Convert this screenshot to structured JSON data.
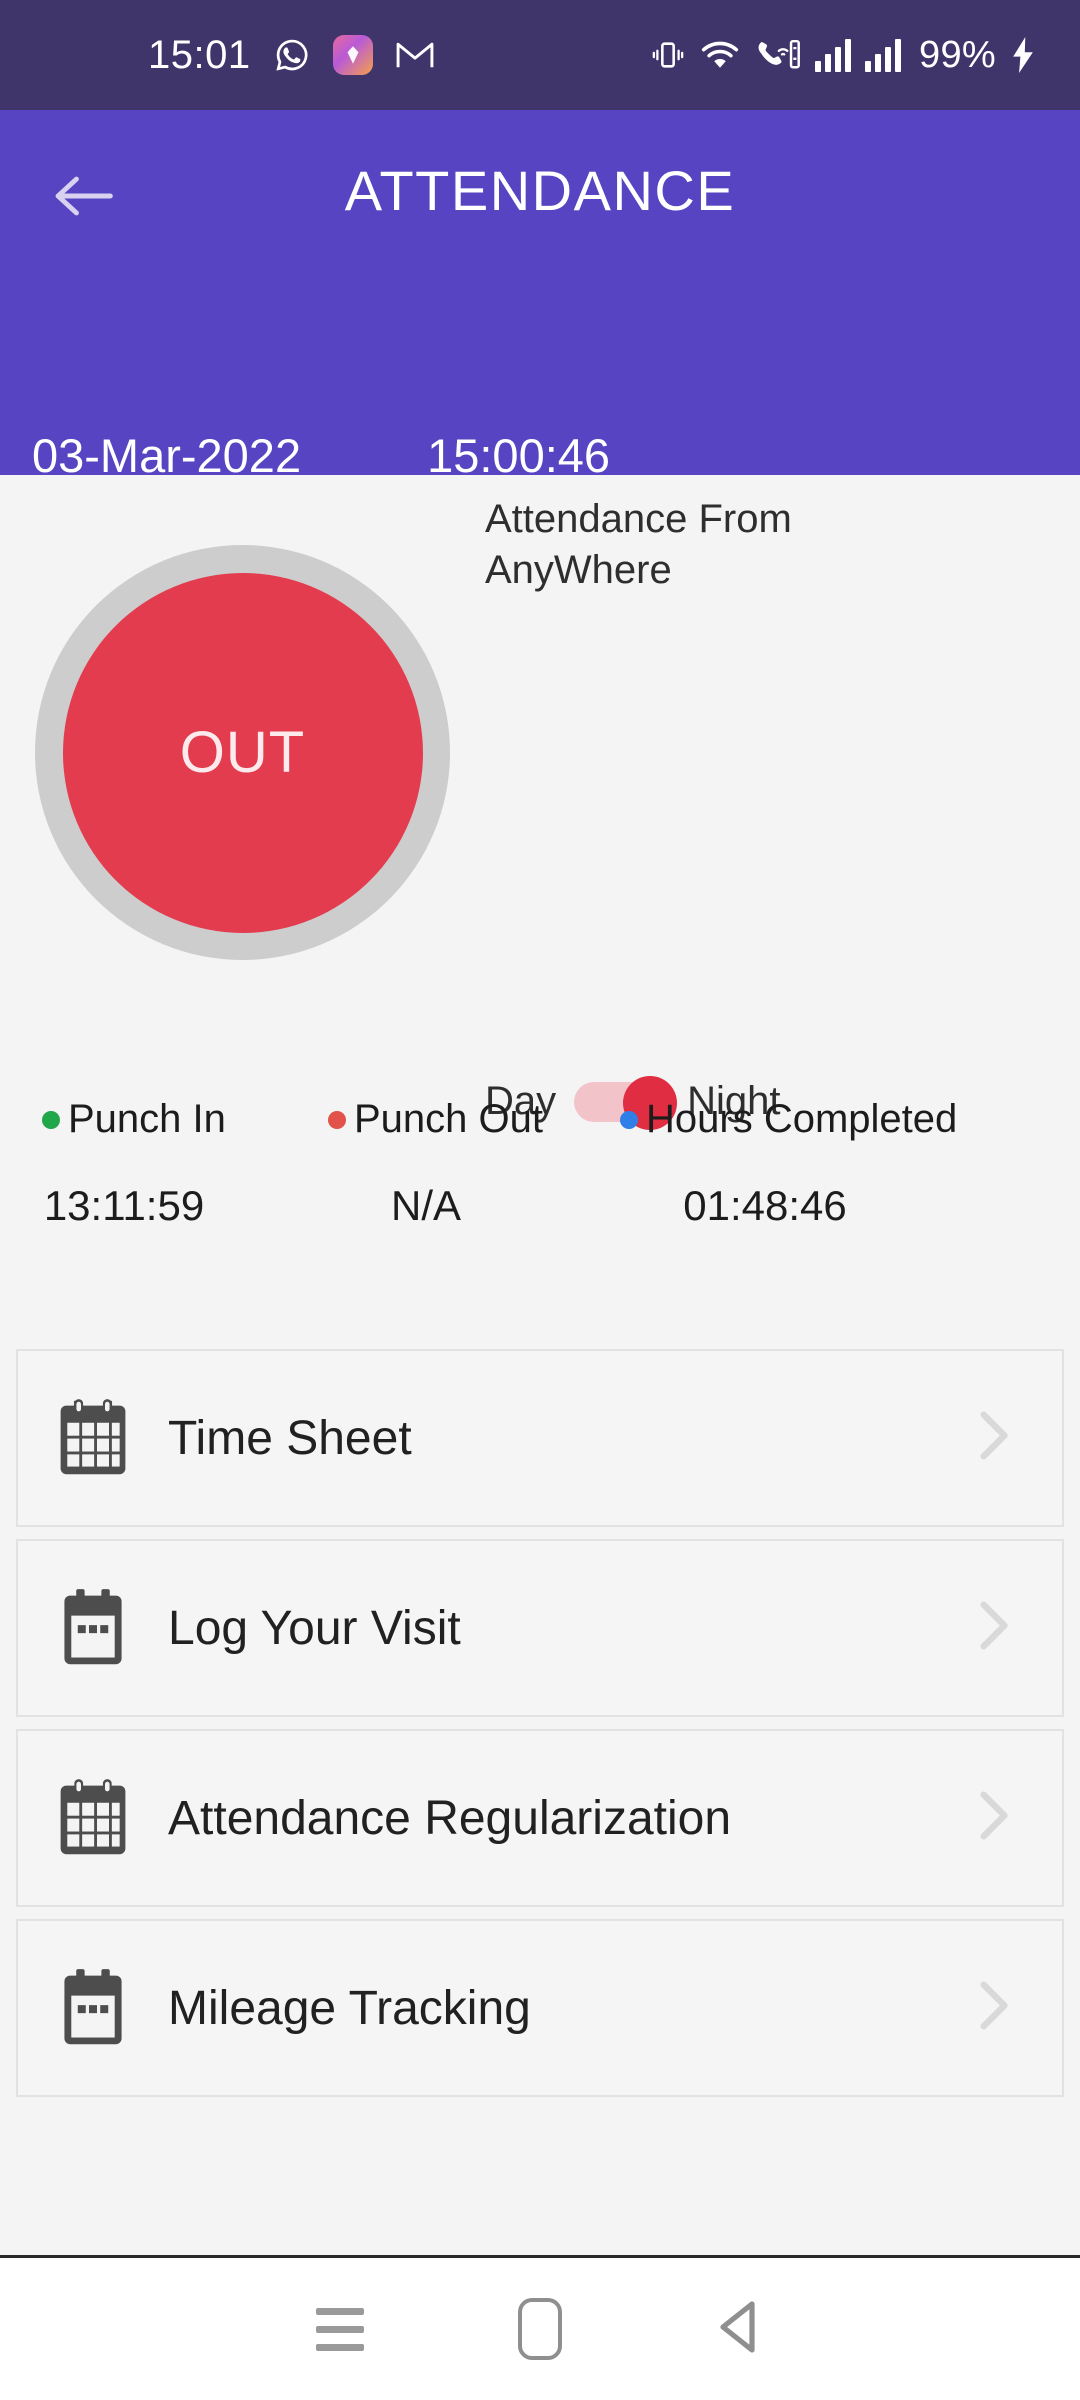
{
  "status_bar": {
    "time": "15:01",
    "battery_percent": "99%",
    "icons": [
      "whatsapp-icon",
      "app-badge-icon",
      "gmail-icon",
      "vibrate-icon",
      "wifi-icon",
      "call-data-icon",
      "signal-bars-icon",
      "signal-bars-2-icon",
      "charging-bolt-icon"
    ]
  },
  "header": {
    "back_icon": "back-arrow-icon",
    "title": "ATTENDANCE",
    "date": "03-Mar-2022",
    "time": "15:00:46",
    "background_color": "#5644C2"
  },
  "punch": {
    "button_label": "OUT",
    "button_color": "#E33C4E",
    "ring_color": "#CDCDCD"
  },
  "attendance_mode": {
    "title": "Attendance From AnyWhere",
    "left_label": "Day",
    "right_label": "Night",
    "selected": "Night",
    "track_color": "#F3C3CA",
    "thumb_color": "#E02D42"
  },
  "stats": [
    {
      "label": "Punch In",
      "value": "13:11:59",
      "dot_color": "#1FA74A"
    },
    {
      "label": "Punch Out",
      "value": "N/A",
      "dot_color": "#E2524A"
    },
    {
      "label": "Hours Completed",
      "value": "01:48:46",
      "dot_color": "#2E7FE8"
    }
  ],
  "menu": [
    {
      "label": "Time Sheet",
      "icon": "calendar-grid-icon"
    },
    {
      "label": "Log Your Visit",
      "icon": "calendar-dots-icon"
    },
    {
      "label": "Attendance Regularization",
      "icon": "calendar-grid-icon"
    },
    {
      "label": "Mileage Tracking",
      "icon": "calendar-dots-icon"
    }
  ],
  "nav_bar": {
    "recent_label": "recent-apps",
    "home_label": "home",
    "back_label": "back"
  }
}
